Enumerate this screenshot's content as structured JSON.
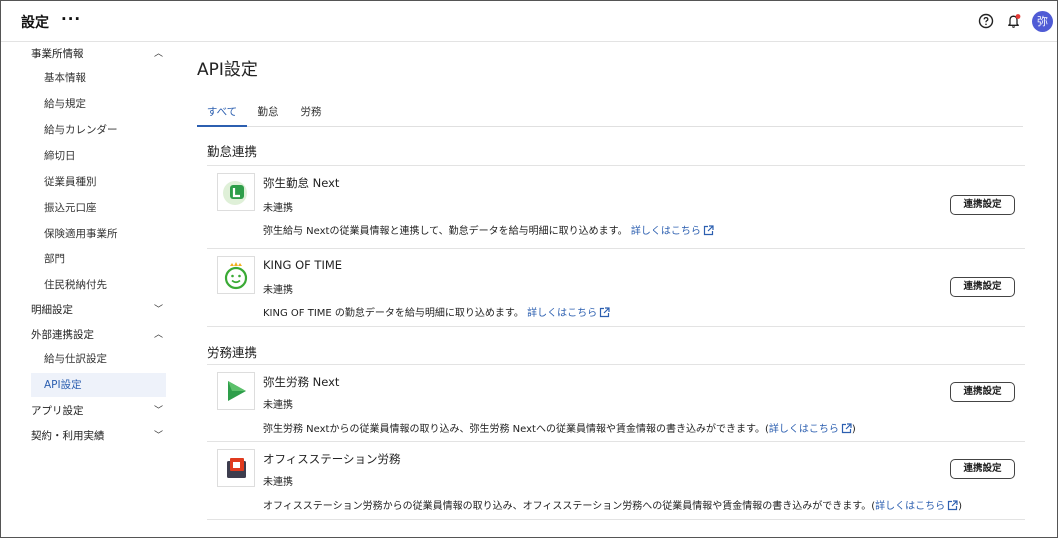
{
  "header": {
    "title": "設定",
    "more_label": "···",
    "avatar_text": "弥",
    "help_icon": "help-circle-icon",
    "bell_icon": "bell-icon",
    "notification_dot_color": "#e53935",
    "avatar_color": "#4f5bd5"
  },
  "sidebar": {
    "groups": {
      "office_info": "事業所情報",
      "detail_settings": "明細設定",
      "external_link": "外部連携設定",
      "app_settings": "アプリ設定",
      "contract": "契約・利用実績"
    },
    "items": {
      "basic_info": "基本情報",
      "pay_rules": "給与規定",
      "pay_calendar": "給与カレンダー",
      "closing_day": "締切日",
      "employee_types": "従業員種別",
      "bank_account": "振込元口座",
      "insurance_office": "保険適用事業所",
      "department": "部門",
      "resident_tax": "住民税納付先",
      "journal_settings": "給与仕訳設定",
      "api_settings": "API設定"
    },
    "active_color": "#2c5fb0"
  },
  "main": {
    "title": "API設定",
    "tabs": [
      "すべて",
      "勤怠",
      "労務"
    ],
    "active_tab": "すべて",
    "sections": {
      "attendance": "勤怠連携",
      "labor": "労務連携"
    },
    "link_label": "詳しくはこちら",
    "button_label": "連携設定",
    "cards": [
      {
        "name": "弥生勤怠 Next",
        "status": "未連携",
        "description": "弥生給与 Nextの従業員情報と連携して、勤怠データを給与明細に取り込めます。",
        "logo": "yayoi-kintai-logo"
      },
      {
        "name": "KING OF TIME",
        "status": "未連携",
        "description": "KING OF TIME の勤怠データを給与明細に取り込めます。",
        "logo": "king-of-time-logo"
      },
      {
        "name": "弥生労務 Next",
        "status": "未連携",
        "description": "弥生労務 Nextからの従業員情報の取り込み、弥生労務 Nextへの従業員情報や賃金情報の書き込みができます。(",
        "suffix": ")",
        "logo": "yayoi-roumu-logo"
      },
      {
        "name": "オフィスステーション労務",
        "status": "未連携",
        "description": "オフィスステーション労務からの従業員情報の取り込み、オフィスステーション労務への従業員情報や賃金情報の書き込みができます。(",
        "suffix": ")",
        "logo": "office-station-logo"
      }
    ],
    "link_color": "#2c5fb0"
  }
}
